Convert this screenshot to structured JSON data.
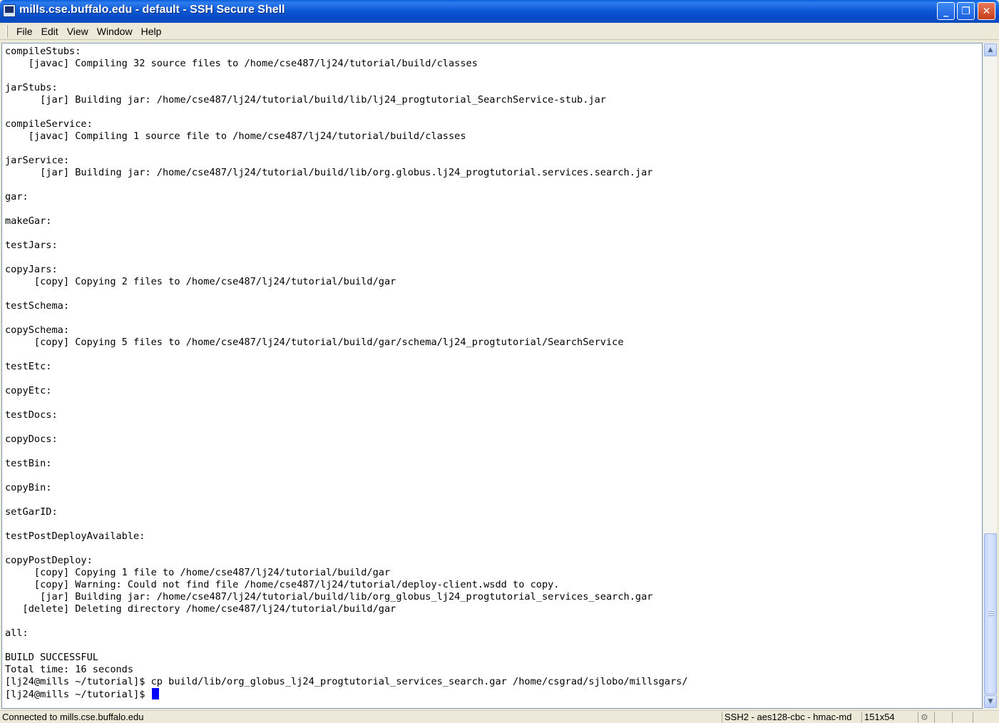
{
  "window": {
    "title": "mills.cse.buffalo.edu - default - SSH Secure Shell",
    "controls": {
      "minimize": "_",
      "maximize": "❐",
      "close": "✕"
    }
  },
  "menu": {
    "items": [
      "File",
      "Edit",
      "View",
      "Window",
      "Help"
    ]
  },
  "terminal": {
    "lines": [
      "compileStubs:",
      "    [javac] Compiling 32 source files to /home/cse487/lj24/tutorial/build/classes",
      "",
      "jarStubs:",
      "      [jar] Building jar: /home/cse487/lj24/tutorial/build/lib/lj24_progtutorial_SearchService-stub.jar",
      "",
      "compileService:",
      "    [javac] Compiling 1 source file to /home/cse487/lj24/tutorial/build/classes",
      "",
      "jarService:",
      "      [jar] Building jar: /home/cse487/lj24/tutorial/build/lib/org.globus.lj24_progtutorial.services.search.jar",
      "",
      "gar:",
      "",
      "makeGar:",
      "",
      "testJars:",
      "",
      "copyJars:",
      "     [copy] Copying 2 files to /home/cse487/lj24/tutorial/build/gar",
      "",
      "testSchema:",
      "",
      "copySchema:",
      "     [copy] Copying 5 files to /home/cse487/lj24/tutorial/build/gar/schema/lj24_progtutorial/SearchService",
      "",
      "testEtc:",
      "",
      "copyEtc:",
      "",
      "testDocs:",
      "",
      "copyDocs:",
      "",
      "testBin:",
      "",
      "copyBin:",
      "",
      "setGarID:",
      "",
      "testPostDeployAvailable:",
      "",
      "copyPostDeploy:",
      "     [copy] Copying 1 file to /home/cse487/lj24/tutorial/build/gar",
      "     [copy] Warning: Could not find file /home/cse487/lj24/tutorial/deploy-client.wsdd to copy.",
      "      [jar] Building jar: /home/cse487/lj24/tutorial/build/lib/org_globus_lj24_progtutorial_services_search.gar",
      "   [delete] Deleting directory /home/cse487/lj24/tutorial/build/gar",
      "",
      "all:",
      "",
      "BUILD SUCCESSFUL",
      "Total time: 16 seconds",
      "[lj24@mills ~/tutorial]$ cp build/lib/org_globus_lj24_progtutorial_services_search.gar /home/csgrad/sjlobo/millsgars/"
    ],
    "prompt": "[lj24@mills ~/tutorial]$ ",
    "cursor_color": "#0000ff"
  },
  "scrollbar": {
    "up_arrow": "▲",
    "down_arrow": "▼"
  },
  "status": {
    "connection": "Connected to mills.cse.buffalo.edu",
    "cipher": "SSH2 - aes128-cbc - hmac-md",
    "size": "151x54"
  },
  "colors": {
    "titlebar": "#0a4cbf",
    "chrome": "#ece9d8",
    "terminal_bg": "#ffffff",
    "terminal_fg": "#000000"
  }
}
